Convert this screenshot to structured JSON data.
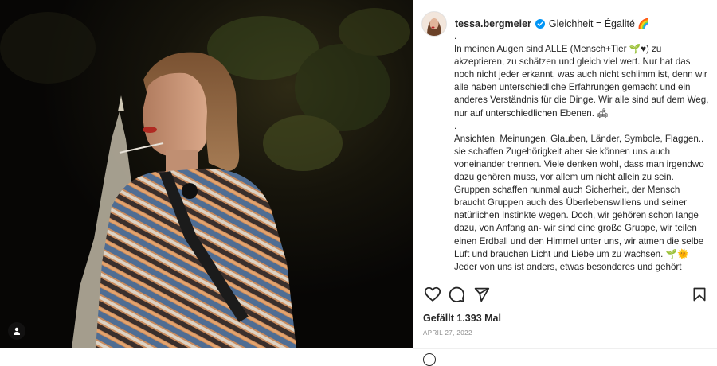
{
  "post": {
    "username": "tessa.bergmeier",
    "title_line": "Gleichheit = Égalité 🌈",
    "caption": [
      ".",
      "In meinen Augen sind ALLE (Mensch+Tier 🌱♥) zu akzeptieren, zu schätzen und gleich viel wert. Nur hat das noch nicht jeder erkannt, was auch nicht schlimm ist, denn wir alle haben unterschiedliche Erfahrungen gemacht und ein anderes Verständnis für die Dinge. Wir alle sind auf dem Weg, nur auf unterschiedlichen Ebenen. 🛋",
      ".",
      "Ansichten, Meinungen, Glauben, Länder, Symbole, Flaggen.. sie schaffen Zugehörigkeit aber sie können uns auch voneinander trennen. Viele denken wohl, dass man irgendwo dazu gehören muss, vor allem um nicht allein zu sein. Gruppen schaffen nunmal auch Sicherheit, der Mensch braucht Gruppen auch des Überlebenswillens und seiner natürlichen Instinkte wegen. Doch, wir gehören schon lange dazu, von Anfang an- wir sind eine große Gruppe, wir teilen einen Erdball und den Himmel unter uns, wir atmen die selbe Luft und brauchen Licht und Liebe um zu wachsen. 🌱🌞",
      "Jeder von uns ist anders, etwas besonderes und gehört trotzdem dazu. Es gibt keine Norm, der es zu entsprechen gilt, gäbe es sie müssten wir uns und/oder andere ständig verbiegen. Und es ist nicht nur eine Kunst geworden sich"
    ],
    "likes": "Gefällt 1.393 Mal",
    "date": "APRIL 27, 2022"
  },
  "icons": {
    "like": "heart-icon",
    "comment": "comment-icon",
    "share": "paper-plane-icon",
    "save": "bookmark-icon",
    "tag": "user-tag-icon",
    "verified": "verified-badge-icon"
  },
  "colors": {
    "text": "#262626",
    "muted": "#8e8e8e",
    "verified": "#0095f6",
    "border": "#efefef"
  }
}
